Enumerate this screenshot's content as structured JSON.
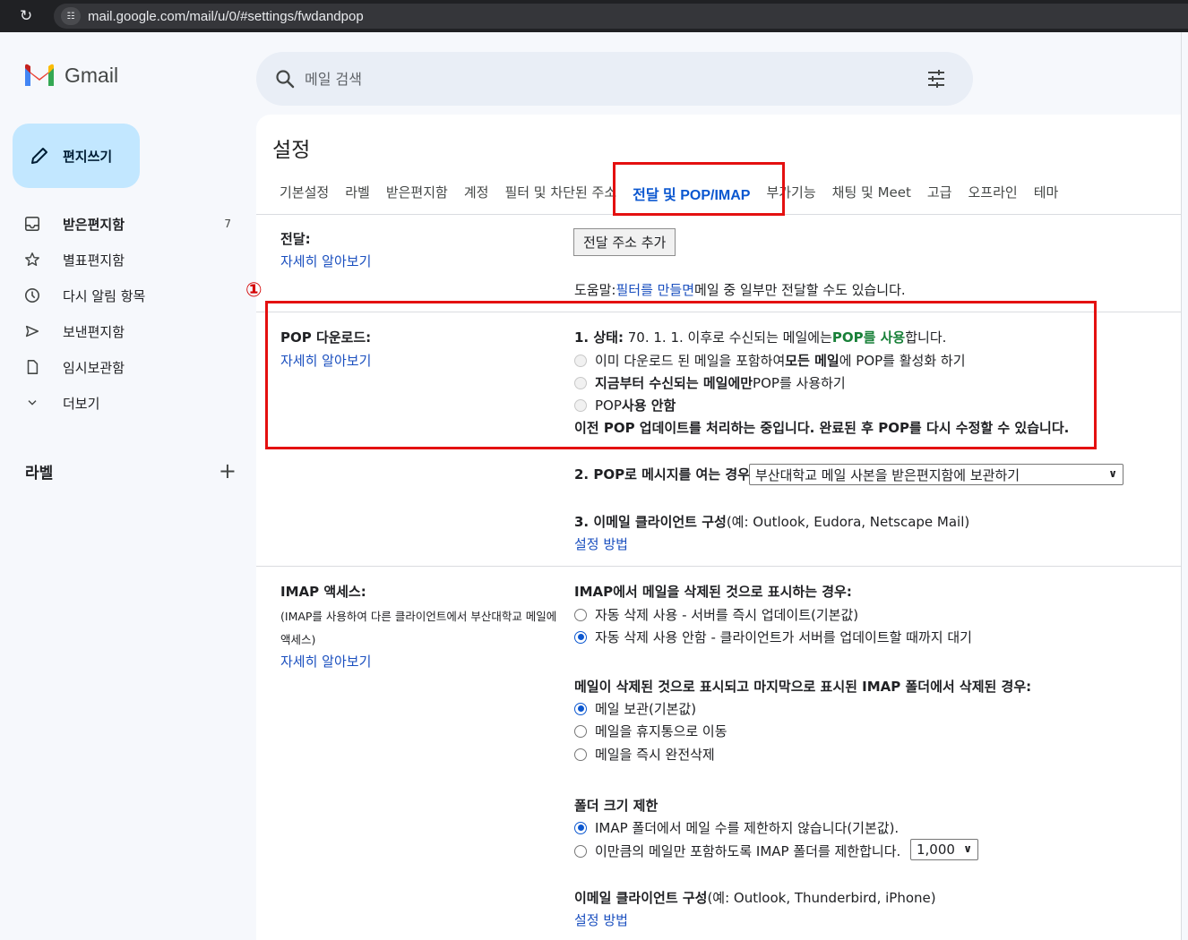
{
  "browser": {
    "url": "mail.google.com/mail/u/0/#settings/fwdandpop"
  },
  "app": {
    "name": "Gmail"
  },
  "search": {
    "placeholder": "메일 검색"
  },
  "compose": {
    "label": "편지쓰기"
  },
  "nav": {
    "items": [
      {
        "label": "받은편지함",
        "count": "7",
        "icon": "inbox-icon"
      },
      {
        "label": "별표편지함",
        "count": "",
        "icon": "star-icon"
      },
      {
        "label": "다시 알림 항목",
        "count": "",
        "icon": "clock-icon"
      },
      {
        "label": "보낸편지함",
        "count": "",
        "icon": "send-icon"
      },
      {
        "label": "임시보관함",
        "count": "",
        "icon": "draft-icon"
      },
      {
        "label": "더보기",
        "count": "",
        "icon": "chevron-down-icon"
      }
    ]
  },
  "labels": {
    "title": "라벨",
    "add": "+"
  },
  "settings": {
    "title": "설정",
    "tabs": [
      "기본설정",
      "라벨",
      "받은편지함",
      "계정",
      "필터 및 차단된 주소",
      "전달 및 POP/IMAP",
      "부가기능",
      "채팅 및 Meet",
      "고급",
      "오프라인",
      "테마"
    ],
    "active_tab": "전달 및 POP/IMAP",
    "forwarding": {
      "label": "전달:",
      "learn_more": "자세히 알아보기",
      "button": "전달 주소 추가",
      "help_prefix": "도움말: ",
      "help_link": "필터를 만들면",
      "help_suffix": " 메일 중 일부만 전달할 수도 있습니다."
    },
    "pop": {
      "label": "POP 다운로드:",
      "learn_more": "자세히 알아보기",
      "status_prefix": "1. 상태: ",
      "status_mid": "70. 1. 1. 이후로 수신되는 메일에는 ",
      "status_green": "POP를 사용",
      "status_suffix": "합니다.",
      "opt1_a": "이미 다운로드 된 메일을 포함하여 ",
      "opt1_b": "모든 메일",
      "opt1_c": "에 POP를 활성화 하기",
      "opt2_a": "지금부터 수신되는 메일에만",
      "opt2_b": " POP를 사용하기",
      "opt3_a": "POP ",
      "opt3_b": "사용 안함",
      "processing": "이전 POP 업데이트를 처리하는 중입니다. 완료된 후 POP를 다시 수정할 수 있습니다.",
      "when_label": "2. POP로 메시지를 여는 경우",
      "when_value": "부산대학교 메일 사본을 받은편지함에 보관하기",
      "client_label": "3. 이메일 클라이언트 구성",
      "client_example": " (예: Outlook, Eudora, Netscape Mail)",
      "setup_link": "설정 방법"
    },
    "imap": {
      "label": "IMAP 액세스:",
      "desc_line1": "(IMAP를 사용하여 다른 클라이언트에서 부산대학교 메일에",
      "desc_line2": "액세스)",
      "learn_more": "자세히 알아보기",
      "deleted_title": "IMAP에서 메일을 삭제된 것으로 표시하는 경우:",
      "auto_on": "자동 삭제 사용 - 서버를 즉시 업데이트(기본값)",
      "auto_off": "자동 삭제 사용 안함 - 클라이언트가 서버를 업데이트할 때까지 대기",
      "expunge_title": "메일이 삭제된 것으로 표시되고 마지막으로 표시된 IMAP 폴더에서 삭제된 경우:",
      "keep": "메일 보관(기본값)",
      "trash": "메일을 휴지통으로 이동",
      "delete": "메일을 즉시 완전삭제",
      "folder_title": "폴더 크기 제한",
      "no_limit": "IMAP 폴더에서 메일 수를 제한하지 않습니다(기본값).",
      "limit": "이만큼의 메일만 포함하도록 IMAP 폴더를 제한합니다.",
      "limit_value": "1,000",
      "client_label": "이메일 클라이언트 구성",
      "client_example": "(예: Outlook, Thunderbird, iPhone)",
      "setup_link": "설정 방법"
    }
  },
  "annotation": {
    "number": "①",
    "color": "#e41010"
  }
}
